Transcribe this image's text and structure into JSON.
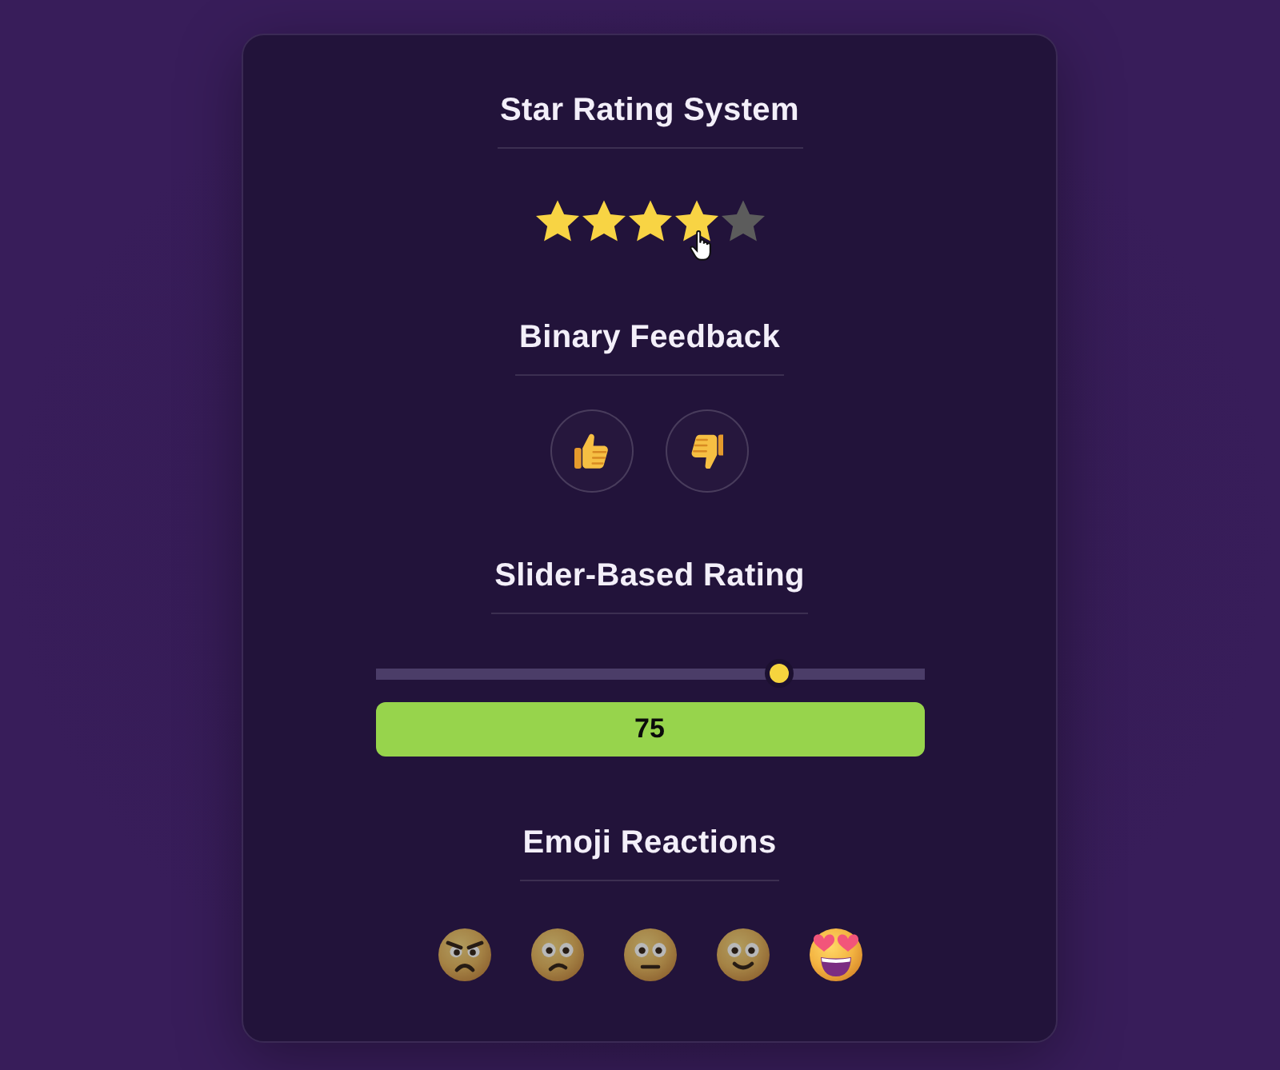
{
  "star_rating": {
    "title": "Star Rating System",
    "stars": 4
  },
  "binary_feedback": {
    "title": "Binary Feedback",
    "buttons": [
      {
        "kind": "thumbs-up"
      },
      {
        "kind": "thumbs-down"
      }
    ]
  },
  "slider_rating": {
    "title": "Slider-Based Rating",
    "level": 0.75,
    "value": "75"
  },
  "emoji_reactions": {
    "title": "Emoji Reactions",
    "items": [
      {
        "kind": "angry",
        "selected": false
      },
      {
        "kind": "frowning",
        "selected": false
      },
      {
        "kind": "neutral",
        "selected": false
      },
      {
        "kind": "smiling",
        "selected": false
      },
      {
        "kind": "heart-eyes",
        "selected": true
      }
    ]
  }
}
